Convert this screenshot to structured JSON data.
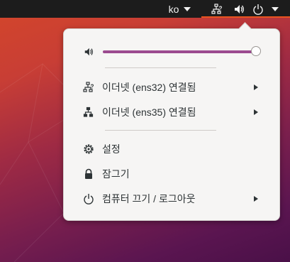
{
  "topbar": {
    "language": "ko",
    "icons": [
      "chevron-down-icon",
      "network-wired-question-icon",
      "speaker-icon",
      "power-icon",
      "chevron-down-icon"
    ],
    "accent": "#e95420"
  },
  "menu": {
    "volume": {
      "icon": "speaker-icon",
      "level": 1.0
    },
    "items": [
      {
        "icon": "network-wired-question-icon",
        "label": "이더넷 (ens32) 연결됨",
        "submenu": true
      },
      {
        "icon": "network-wired-icon",
        "label": "이더넷 (ens35) 연결됨",
        "submenu": true
      },
      {
        "icon": "gear-icon",
        "label": "설정",
        "submenu": false
      },
      {
        "icon": "lock-icon",
        "label": "잠그기",
        "submenu": false
      },
      {
        "icon": "power-icon",
        "label": "컴퓨터 끄기 / 로그아웃",
        "submenu": true
      }
    ],
    "background": "#f6f5f4",
    "slider_color": "#9b4a8f"
  }
}
